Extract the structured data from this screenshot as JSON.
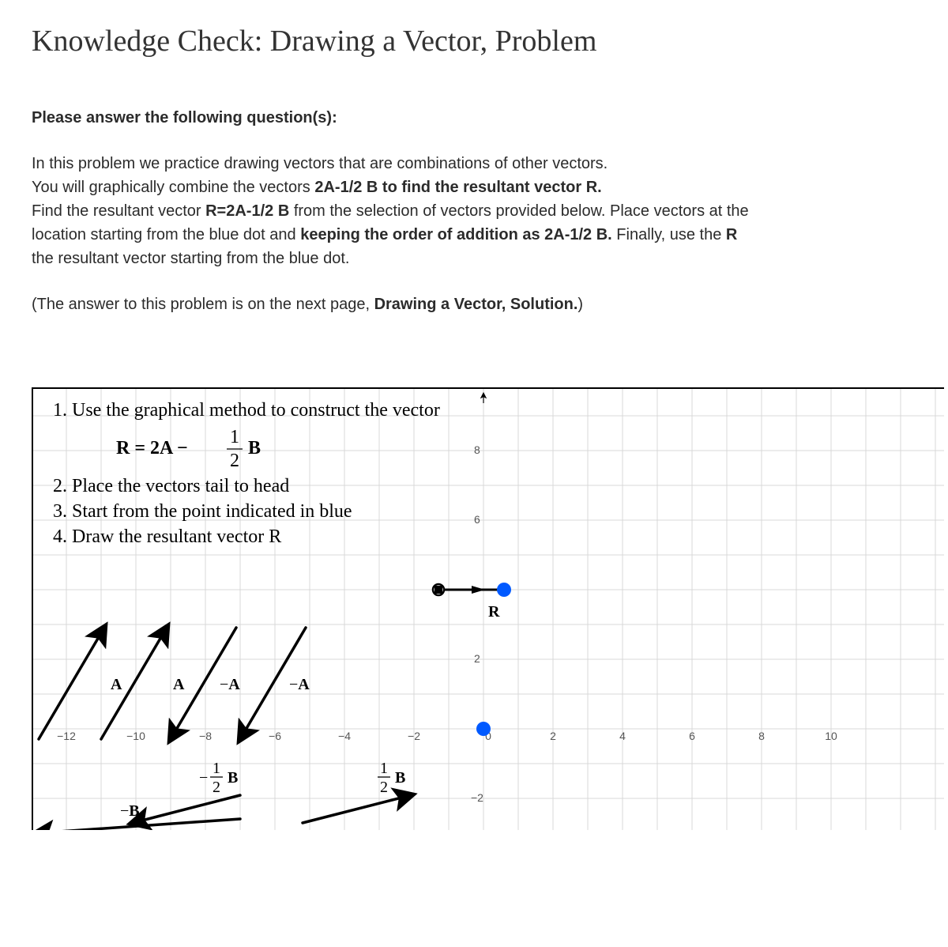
{
  "title": "Knowledge Check: Drawing a Vector, Problem",
  "lead": "Please answer the following question(s):",
  "para1_l1": "In this problem we practice drawing vectors that are combinations of other vectors.",
  "para1_l2a": "You will graphically combine the vectors ",
  "para1_l2b": "2A-1/2 B to find the resultant vector R.",
  "para1_l3a": "Find the resultant vector ",
  "para1_l3b": "R=2A-1/2 B",
  "para1_l3c": " from the selection of vectors provided below. Place vectors at the",
  "para1_l4a": "location starting from the blue dot and ",
  "para1_l4b": "keeping the order of addition as 2A-1/2 B.",
  "para1_l4c": " Finally, use the ",
  "para1_l4d": "R",
  "para1_l5": "the  resultant vector starting from the blue dot.",
  "para2a": "(The answer to this problem is on the next page, ",
  "para2b": "Drawing a Vector, Solution.",
  "para2c": ")",
  "steps": {
    "s1": "1. Use the graphical method to construct the vector",
    "eq_pre": "R = 2A − ",
    "eq_frac_num": "1",
    "eq_frac_den": "2",
    "eq_post": "B",
    "s2": "2. Place the vectors tail to head",
    "s3": "3. Start from the point indicated in blue",
    "s4": "4. Draw the resultant vector R"
  },
  "veclabels": {
    "A": "A",
    "mA": "−A",
    "R": "R",
    "B": "B",
    "mB": "−B",
    "halfB_num": "1",
    "halfB_den": "2",
    "neg": "−"
  },
  "axis": {
    "y8": "8",
    "y6": "6",
    "y2": "2",
    "ym2": "−2",
    "xm12": "−12",
    "xm10": "−10",
    "xm8": "−8",
    "xm6": "−6",
    "xm4": "−4",
    "xm2": "−2",
    "x0": "0",
    "x2": "2",
    "x4": "4",
    "x6": "6",
    "x8": "8",
    "x10": "10"
  },
  "chart_data": {
    "type": "diagram",
    "description": "Cartesian grid with draggable vectors for constructing R = 2A - (1/2)B",
    "x_range": [
      -13,
      11
    ],
    "y_range": [
      -3,
      9
    ],
    "x_ticks": [
      -12,
      -10,
      -8,
      -6,
      -4,
      -2,
      0,
      2,
      4,
      6,
      8,
      10
    ],
    "y_ticks": [
      -2,
      2,
      6,
      8
    ],
    "start_point": {
      "x": 0,
      "y": 0,
      "color": "blue"
    },
    "r_tool": {
      "segment": [
        [
          -1.3,
          4
        ],
        [
          0.6,
          4
        ]
      ],
      "terminal_dot": [
        0.6,
        4
      ],
      "label_pos": [
        0.2,
        3.3
      ]
    },
    "vectors": [
      {
        "name": "A",
        "tail": [
          -12.8,
          -0.3
        ],
        "head": [
          -10.9,
          2.9
        ],
        "label": "A",
        "label_pos": [
          -11.1,
          1.3
        ]
      },
      {
        "name": "A2",
        "tail": [
          -11,
          -0.3
        ],
        "head": [
          -9.1,
          2.9
        ],
        "label": "A",
        "label_pos": [
          -9.3,
          1.3
        ]
      },
      {
        "name": "-A",
        "tail": [
          -7.1,
          2.9
        ],
        "head": [
          -9,
          -0.3
        ],
        "label": "−A",
        "label_pos": [
          -7.6,
          1.3
        ]
      },
      {
        "name": "-A2",
        "tail": [
          -5.1,
          2.9
        ],
        "head": [
          -7,
          -0.3
        ],
        "label": "−A",
        "label_pos": [
          -5.6,
          1.3
        ]
      },
      {
        "name": "-1/2B",
        "tail": [
          -7,
          -1.9
        ],
        "head": [
          -10.1,
          -2.7
        ],
        "label": "−½B",
        "label_pos": [
          -8.4,
          -1.4
        ]
      },
      {
        "name": "1/2B",
        "tail": [
          -5.2,
          -2.7
        ],
        "head": [
          -2.1,
          -1.9
        ],
        "label": "½B",
        "label_pos": [
          -3.1,
          -1.4
        ]
      },
      {
        "name": "-B",
        "tail": [
          -7,
          -2.6
        ],
        "head": [
          -13.2,
          -3.0
        ],
        "label": "−B",
        "label_pos": [
          -10.2,
          -2.3
        ]
      }
    ]
  }
}
